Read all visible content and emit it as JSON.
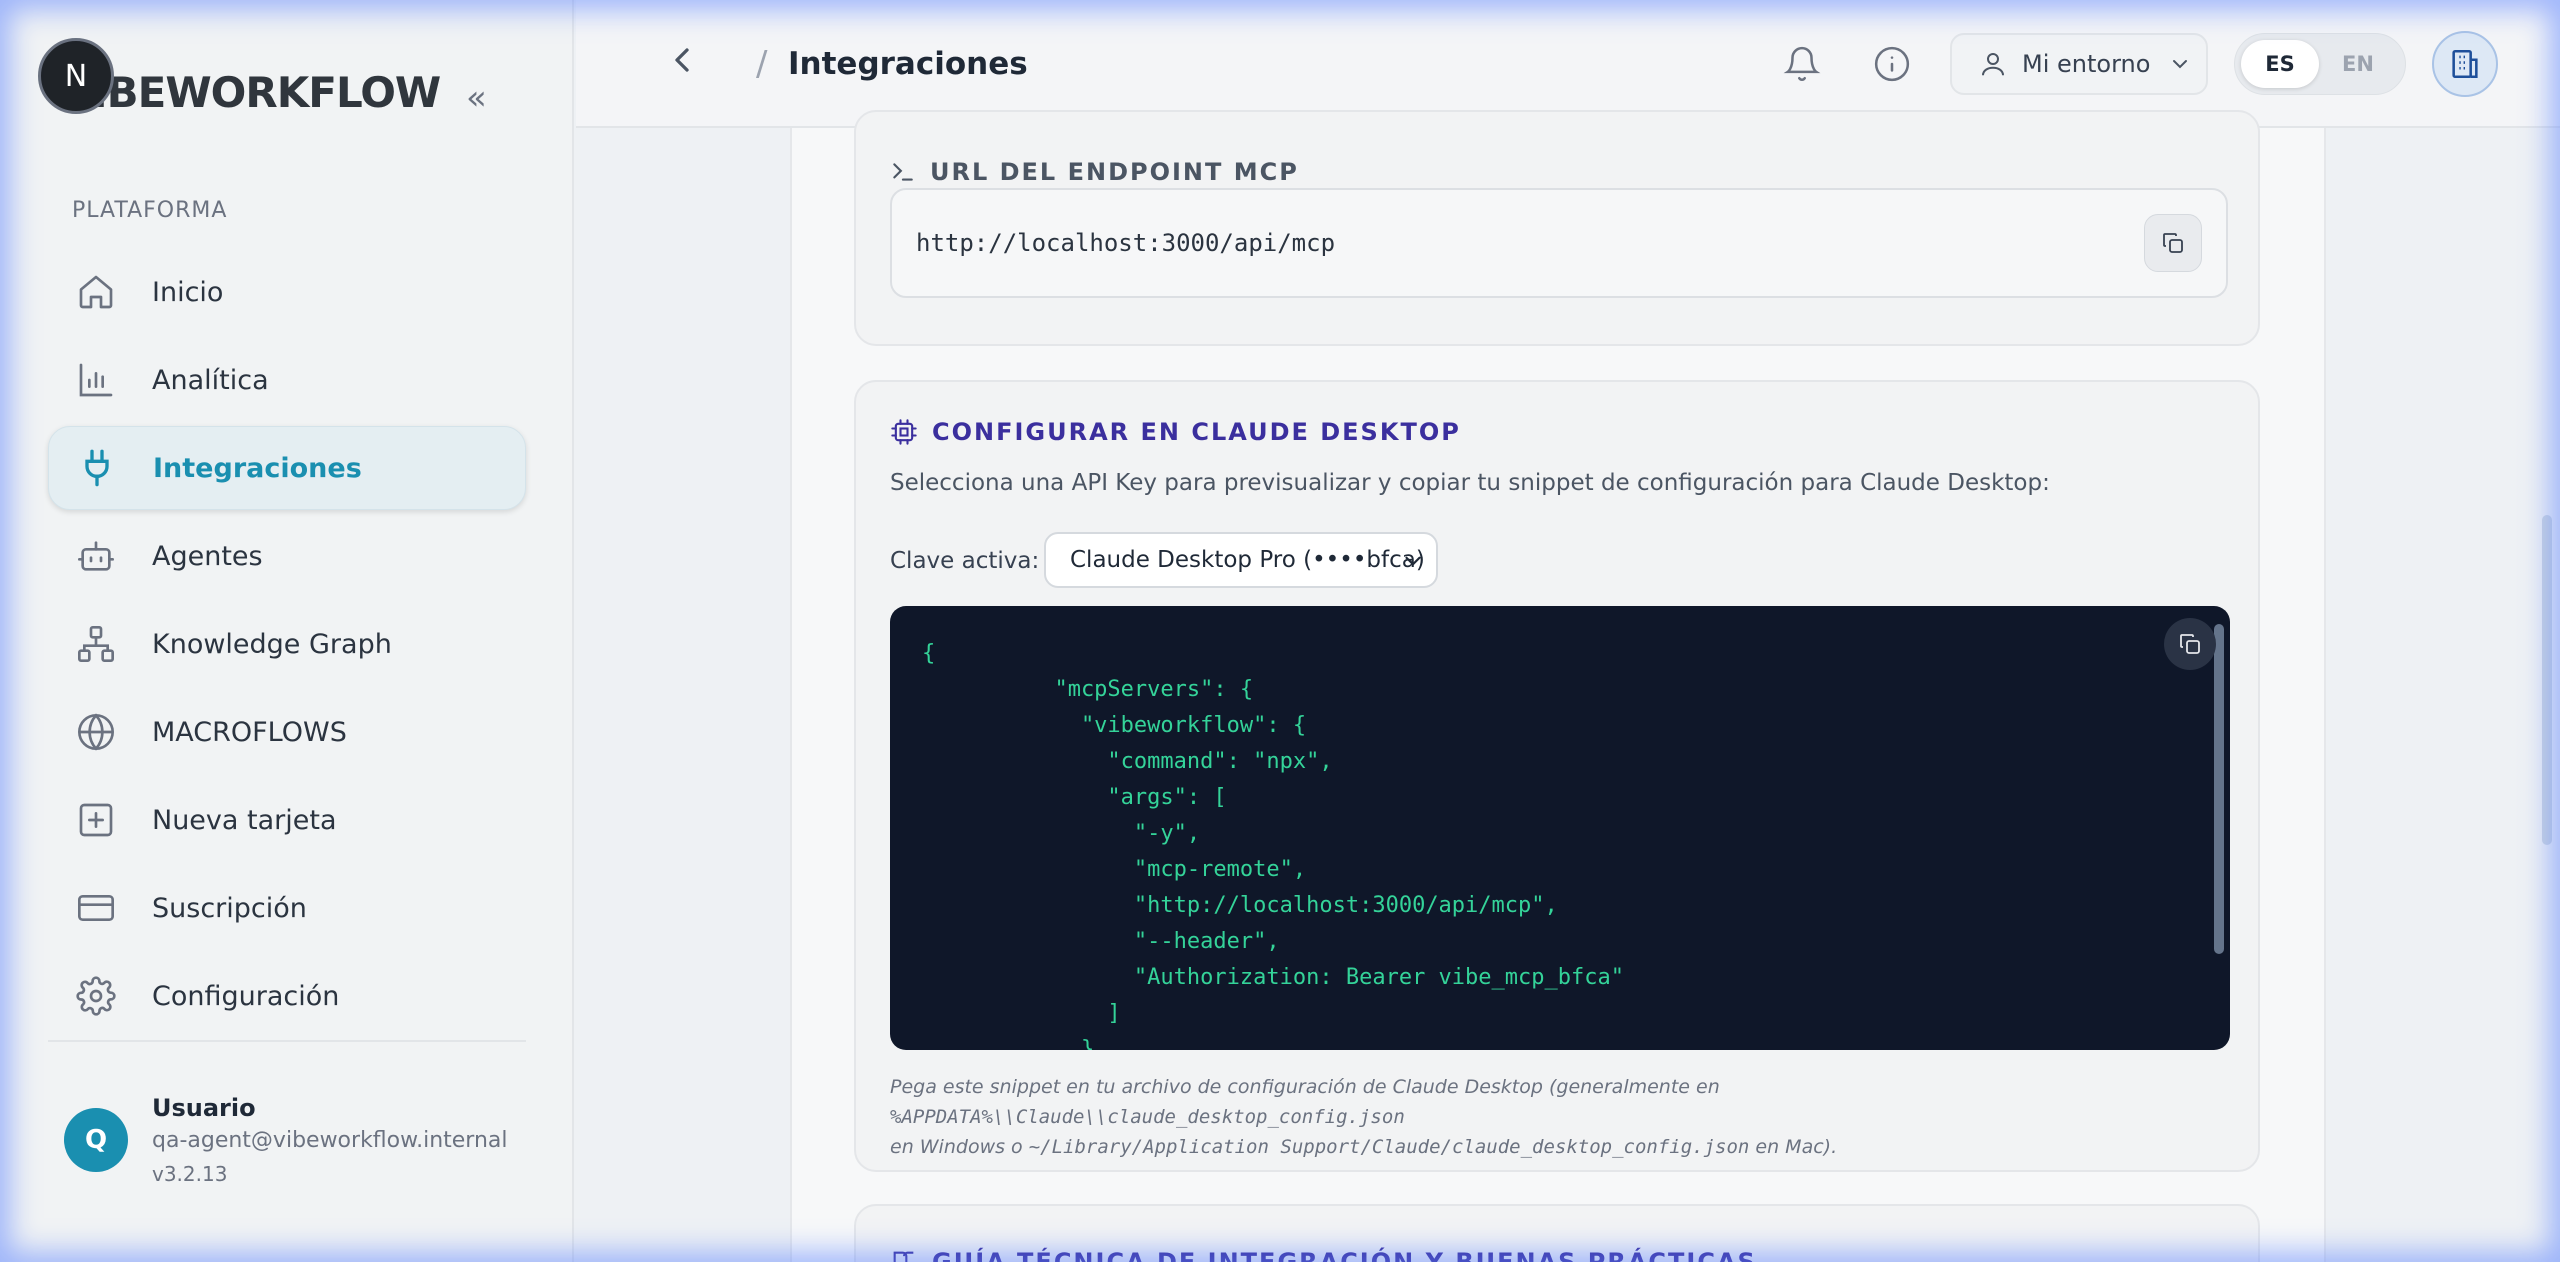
{
  "sidebar": {
    "logo_letter": "N",
    "logo_text": "IBEWORKFLOW",
    "collapse_icon": "«",
    "section_label": "PLATAFORMA",
    "items": [
      {
        "label": "Inicio",
        "icon": "home-icon"
      },
      {
        "label": "Analítica",
        "icon": "bar-chart-icon"
      },
      {
        "label": "Integraciones",
        "icon": "plug-icon",
        "active": true
      },
      {
        "label": "Agentes",
        "icon": "bot-icon"
      },
      {
        "label": "Knowledge Graph",
        "icon": "network-icon"
      },
      {
        "label": "MACROFLOWS",
        "icon": "globe-icon"
      },
      {
        "label": "Nueva tarjeta",
        "icon": "plus-square-icon"
      },
      {
        "label": "Suscripción",
        "icon": "credit-card-icon"
      },
      {
        "label": "Configuración",
        "icon": "gear-icon"
      }
    ],
    "user": {
      "initial": "Q",
      "name": "Usuario",
      "email": "qa-agent@vibeworkflow.internal",
      "version": "v3.2.13"
    }
  },
  "header": {
    "separator": "/",
    "title": "Integraciones",
    "environment_label": "Mi entorno",
    "languages": [
      "ES",
      "EN"
    ],
    "active_language": "ES"
  },
  "endpoint_card": {
    "title": "URL DEL ENDPOINT MCP",
    "url": "http://localhost:3000/api/mcp"
  },
  "claude_card": {
    "title": "CONFIGURAR EN CLAUDE DESKTOP",
    "description": "Selecciona una API Key para previsualizar y copiar tu snippet de configuración para Claude Desktop:",
    "key_label": "Clave activa:",
    "key_selected": "Claude Desktop Pro (••••bfca)",
    "code": "{\n          \"mcpServers\": {\n            \"vibeworkflow\": {\n              \"command\": \"npx\",\n              \"args\": [\n                \"-y\",\n                \"mcp-remote\",\n                \"http://localhost:3000/api/mcp\",\n                \"--header\",\n                \"Authorization: Bearer vibe_mcp_bfca\"\n              ]\n            }",
    "hint_1": "Pega este snippet en tu archivo de configuración de Claude Desktop (generalmente en ",
    "hint_path_win": "%APPDATA%\\\\Claude\\\\claude_desktop_config.json",
    "hint_2": "en Windows o ",
    "hint_path_mac": "~/Library/Application Support/Claude/claude_desktop_config.json",
    "hint_3": " en Mac)."
  },
  "guide_card": {
    "title": "GUÍA TÉCNICA DE INTEGRACIÓN Y BUENAS PRÁCTICAS"
  },
  "colors": {
    "accent": "#1a8fb0",
    "title_purple": "#3b2f9e",
    "code_bg": "#0f1729",
    "code_text": "#34d399"
  }
}
